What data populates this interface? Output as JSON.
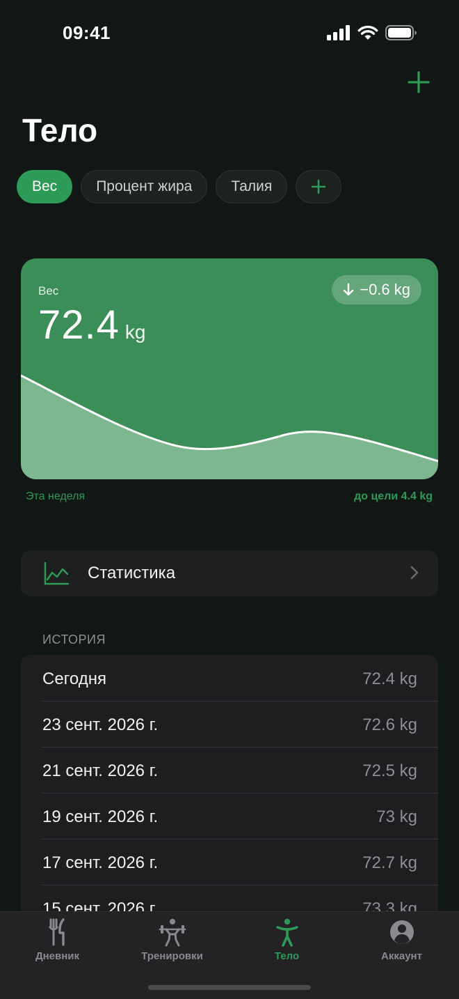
{
  "status": {
    "time": "09:41"
  },
  "page": {
    "title": "Тело"
  },
  "metric_tabs": [
    {
      "label": "Вес",
      "active": true
    },
    {
      "label": "Процент жира",
      "active": false
    },
    {
      "label": "Талия",
      "active": false
    }
  ],
  "card": {
    "label": "Вес",
    "value": "72.4",
    "unit": "kg",
    "delta": "−0.6 kg",
    "period_label": "Эта неделя",
    "goal_label": "до цели 4.4 kg"
  },
  "stats": {
    "label": "Статистика"
  },
  "history": {
    "header": "ИСТОРИЯ",
    "rows": [
      {
        "date": "Сегодня",
        "value": "72.4 kg"
      },
      {
        "date": "23 сент. 2026 г.",
        "value": "72.6 kg"
      },
      {
        "date": "21 сент. 2026 г.",
        "value": "72.5 kg"
      },
      {
        "date": "19 сент. 2026 г.",
        "value": "73 kg"
      },
      {
        "date": "17 сент. 2026 г.",
        "value": "72.7 kg"
      },
      {
        "date": "15 сент. 2026 г.",
        "value": "73.3 kg"
      }
    ]
  },
  "tabbar": [
    {
      "label": "Дневник",
      "icon": "fork-knife-icon",
      "active": false
    },
    {
      "label": "Тренировки",
      "icon": "weightlifter-icon",
      "active": false
    },
    {
      "label": "Тело",
      "icon": "body-figure-icon",
      "active": true
    },
    {
      "label": "Аккаунт",
      "icon": "account-circle-icon",
      "active": false
    }
  ],
  "colors": {
    "accent": "#2e9a58",
    "card": "#3b8e57",
    "background": "#111714"
  }
}
